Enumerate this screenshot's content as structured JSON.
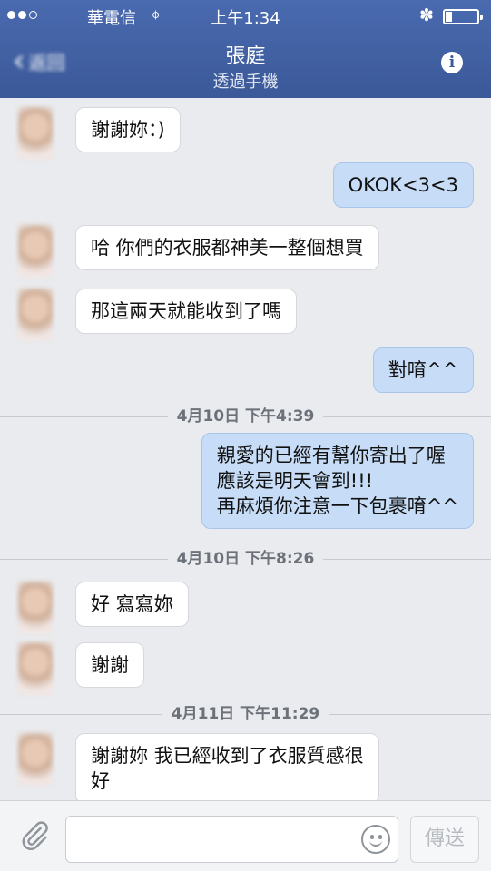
{
  "status_bar": {
    "carrier": "華電信",
    "time": "上午1:34",
    "battery_level": 0.2
  },
  "nav": {
    "back_label": "返回",
    "title": "張庭",
    "subtitle": "透過手機"
  },
  "messages": [
    {
      "dir": "in",
      "text": "謝謝妳：)"
    },
    {
      "dir": "out",
      "text": "OKOK<3<3"
    },
    {
      "dir": "in",
      "text": "哈 你們的衣服都神美一整個想買"
    },
    {
      "dir": "in",
      "text": "那這兩天就能收到了嗎"
    },
    {
      "dir": "out",
      "text": "對唷^^"
    },
    {
      "sep": "4月10日 下午4:39"
    },
    {
      "dir": "out",
      "lines": [
        "親愛的已經有幫你寄出了喔",
        "應該是明天會到!!!",
        "再麻煩你注意一下包裹唷^^"
      ]
    },
    {
      "sep": "4月10日 下午8:26"
    },
    {
      "dir": "in",
      "text": "好 寫寫妳"
    },
    {
      "dir": "in",
      "text": "謝謝"
    },
    {
      "sep": "4月11日 下午11:29"
    },
    {
      "dir": "in",
      "lines": [
        "謝謝妳 我已經收到了衣服質感很",
        "好"
      ]
    }
  ],
  "composer": {
    "placeholder": "",
    "send_label": "傳送"
  },
  "colors": {
    "nav": "#3b5998",
    "outgoing": "#c7ddf7",
    "incoming": "#ffffff",
    "background": "#e9ebee"
  }
}
